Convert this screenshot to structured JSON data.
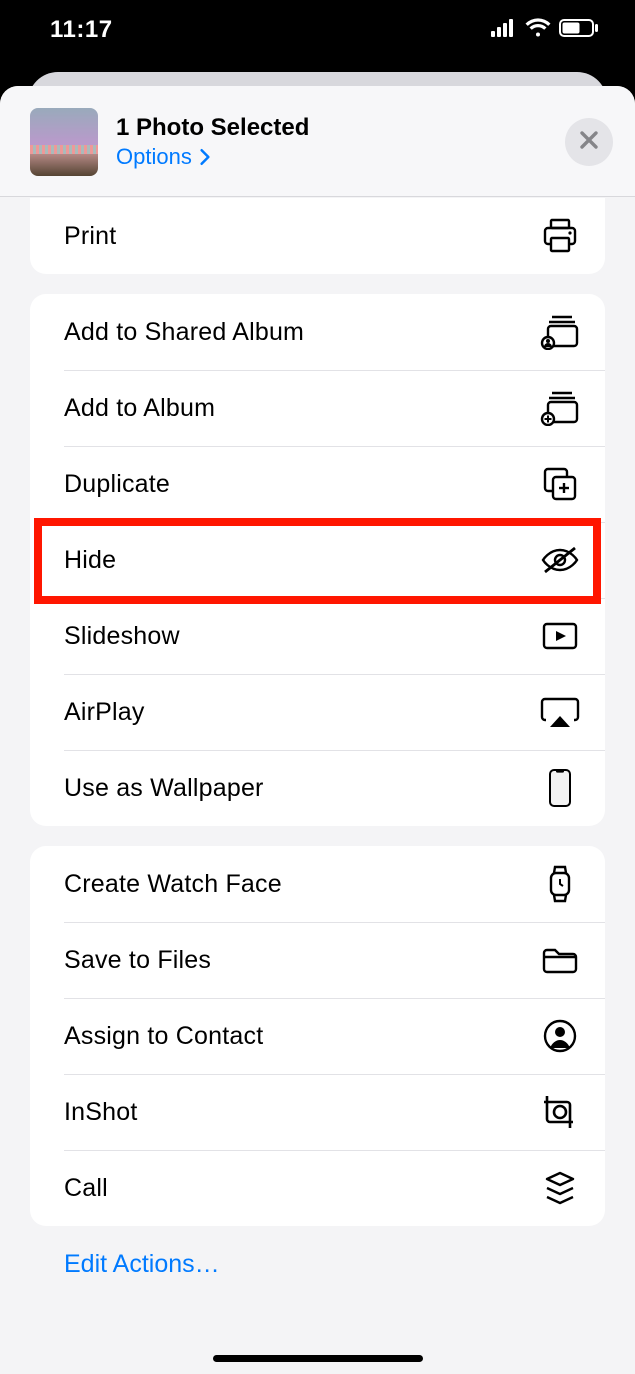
{
  "statusbar": {
    "time": "11:17"
  },
  "header": {
    "title": "1 Photo Selected",
    "options_label": "Options"
  },
  "groups": [
    {
      "rows": [
        {
          "label": "Print",
          "icon": "print-icon"
        }
      ]
    },
    {
      "rows": [
        {
          "label": "Add to Shared Album",
          "icon": "shared-album-icon"
        },
        {
          "label": "Add to Album",
          "icon": "add-album-icon"
        },
        {
          "label": "Duplicate",
          "icon": "duplicate-icon"
        },
        {
          "label": "Hide",
          "icon": "hide-icon",
          "highlighted": true
        },
        {
          "label": "Slideshow",
          "icon": "slideshow-icon"
        },
        {
          "label": "AirPlay",
          "icon": "airplay-icon"
        },
        {
          "label": "Use as Wallpaper",
          "icon": "wallpaper-icon"
        }
      ]
    },
    {
      "rows": [
        {
          "label": "Create Watch Face",
          "icon": "watch-icon"
        },
        {
          "label": "Save to Files",
          "icon": "folder-icon"
        },
        {
          "label": "Assign to Contact",
          "icon": "contact-icon"
        },
        {
          "label": "InShot",
          "icon": "inshot-icon"
        },
        {
          "label": "Call",
          "icon": "call-stack-icon"
        }
      ]
    }
  ],
  "footer": {
    "edit_actions": "Edit Actions…"
  }
}
